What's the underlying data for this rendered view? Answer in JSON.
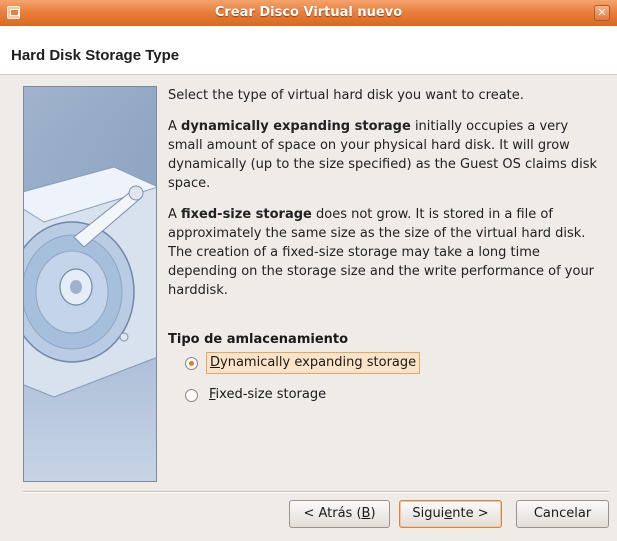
{
  "window": {
    "title": "Crear Disco Virtual nuevo",
    "close_glyph": "✕",
    "accent": "#e9803e"
  },
  "page": {
    "title": "Hard Disk Storage Type"
  },
  "description": {
    "p1": "Select the type of virtual hard disk you want to create.",
    "p2_prefix": "A ",
    "p2_bold": "dynamically expanding storage",
    "p2_rest": " initially occupies a very small amount of space on your physical hard disk. It will grow dynamically (up to the size specified) as the Guest OS claims disk space.",
    "p3_prefix": "A ",
    "p3_bold": "fixed-size storage",
    "p3_rest": " does not grow. It is stored in a file of approximately the same size as the size of the virtual hard disk. The creation of a fixed-size storage may take a long time depending on the storage size and the write performance of your harddisk."
  },
  "storage_type": {
    "group_label": "Tipo de amlacenamiento",
    "options": [
      {
        "mnemonic": "D",
        "rest": "ynamically expanding storage",
        "checked": true
      },
      {
        "mnemonic": "F",
        "rest": "ixed-size storage",
        "checked": false
      }
    ]
  },
  "buttons": {
    "back_prefix": "< Atrás (",
    "back_mnemonic": "B",
    "back_suffix": ")",
    "next_prefix": "Sigui",
    "next_mnemonic": "e",
    "next_suffix": "nte >",
    "cancel": "Cancelar"
  },
  "icons": {
    "window": "virtualbox-window-icon",
    "close": "close-icon",
    "illustration": "hard-disk-icon"
  }
}
